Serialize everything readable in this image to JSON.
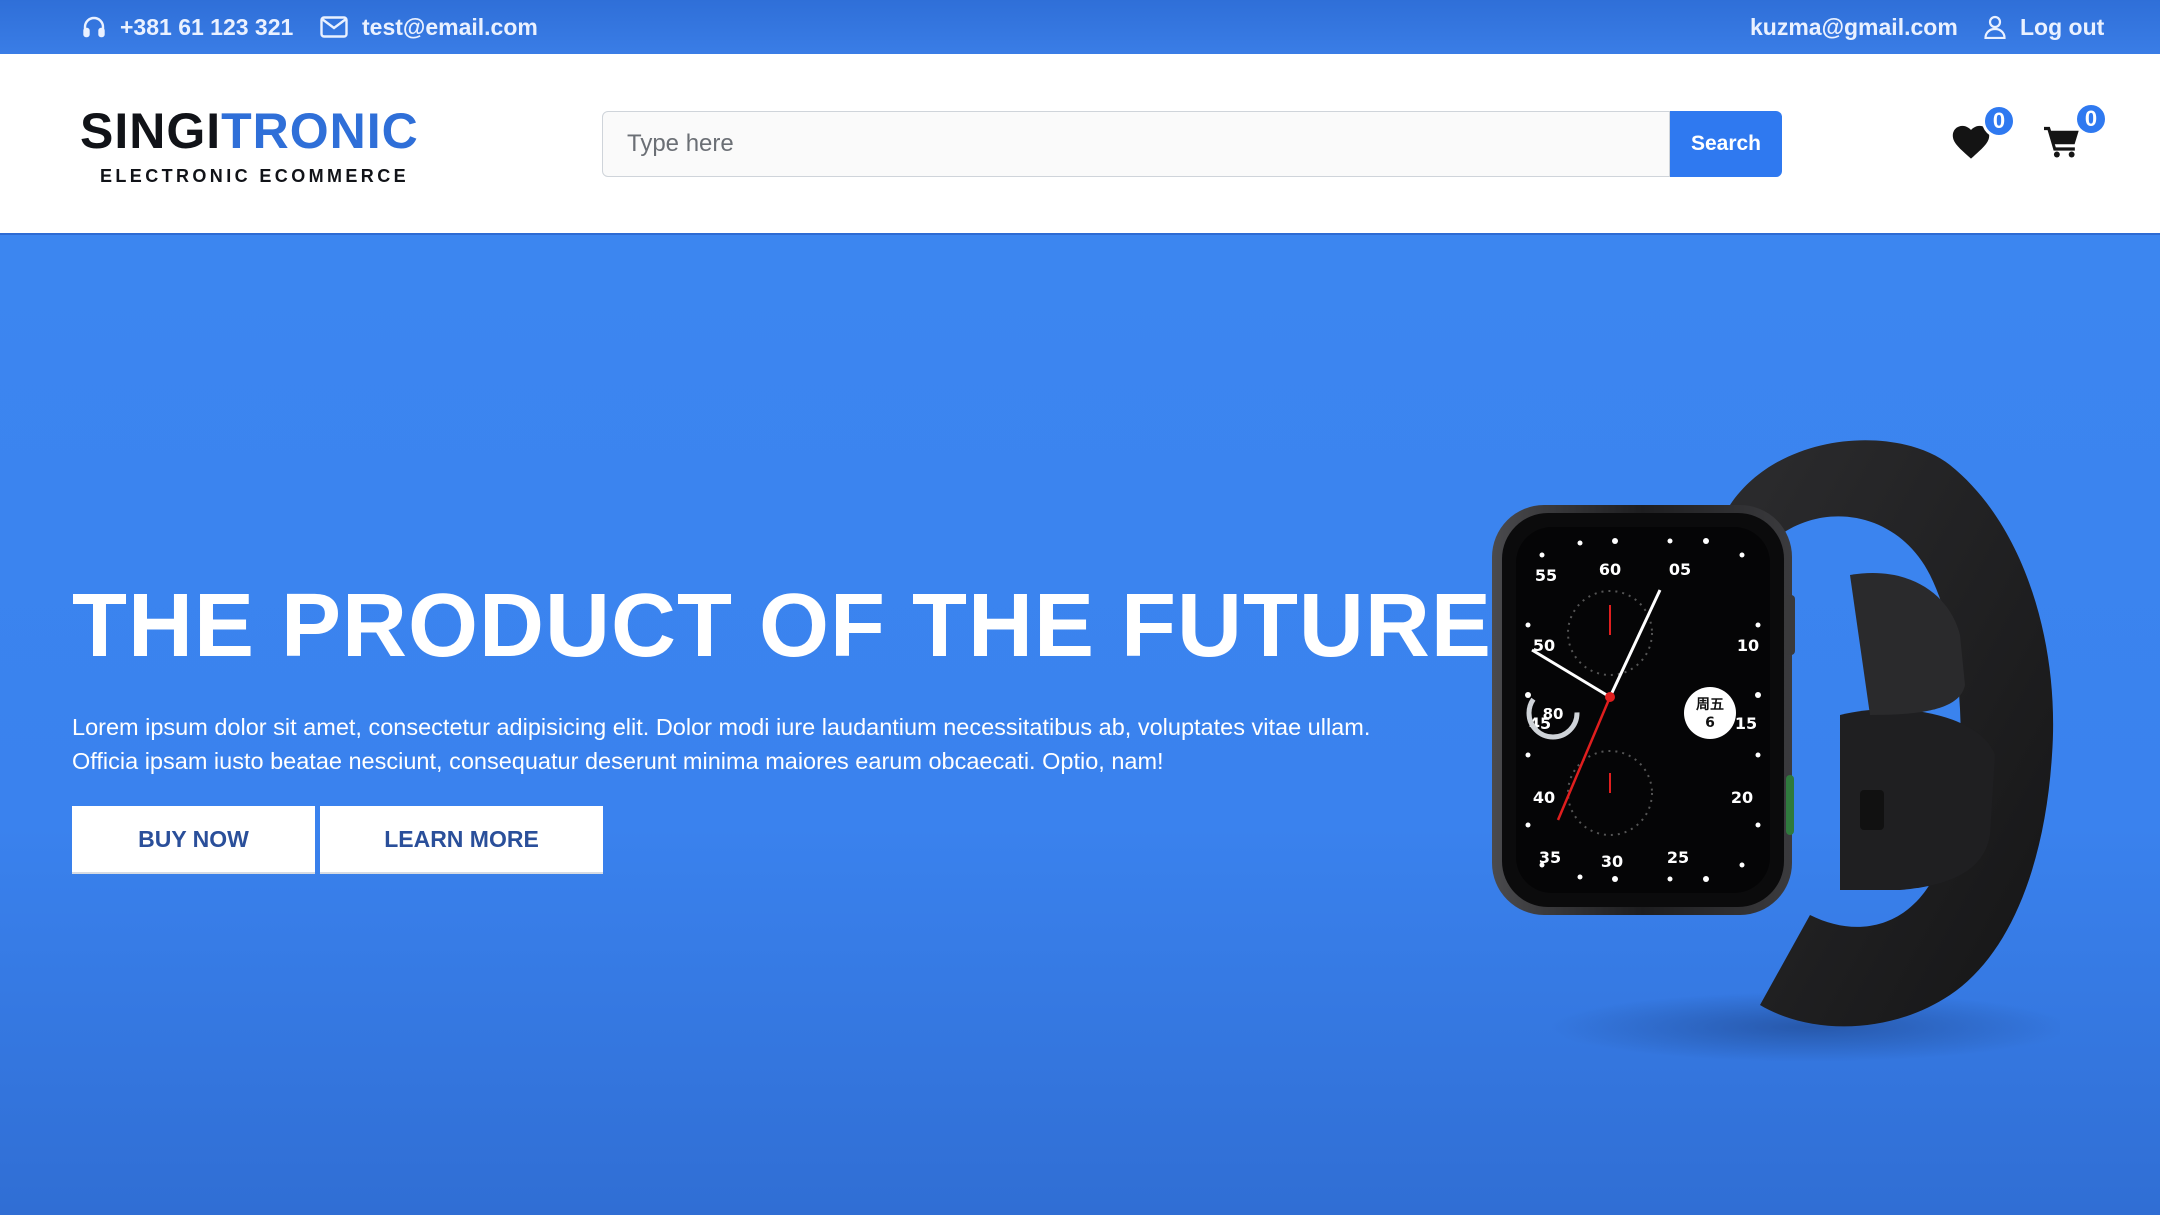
{
  "topbar": {
    "phone": "+381 61 123 321",
    "email": "test@email.com",
    "user_email": "kuzma@gmail.com",
    "logout_label": "Log out",
    "icons": {
      "phone": "headphones-icon",
      "email": "envelope-icon",
      "user": "user-icon"
    }
  },
  "header": {
    "logo_part1": "SINGI",
    "logo_part2": "TRONIC",
    "logo_subtitle": "ELECTRONIC ECOMMERCE",
    "search_placeholder": "Type here",
    "search_button": "Search",
    "wishlist_count": "0",
    "cart_count": "0",
    "icons": {
      "wishlist": "heart-icon",
      "cart": "cart-icon"
    }
  },
  "hero": {
    "title": "THE PRODUCT OF THE FUTURE",
    "description": "Lorem ipsum dolor sit amet, consectetur adipisicing elit. Dolor modi iure laudantium necessitatibus ab, voluptates vitae ullam. Officia ipsam iusto beatae nesciunt, consequatur deserunt minima maiores earum obcaecati. Optio, nam!",
    "buy_now": "BUY NOW",
    "learn_more": "LEARN MORE",
    "image": "smartwatch-image"
  },
  "colors": {
    "accent": "#2f79f0",
    "hero_bg": "#3b82ec",
    "logo_blue": "#2f6fd8"
  }
}
